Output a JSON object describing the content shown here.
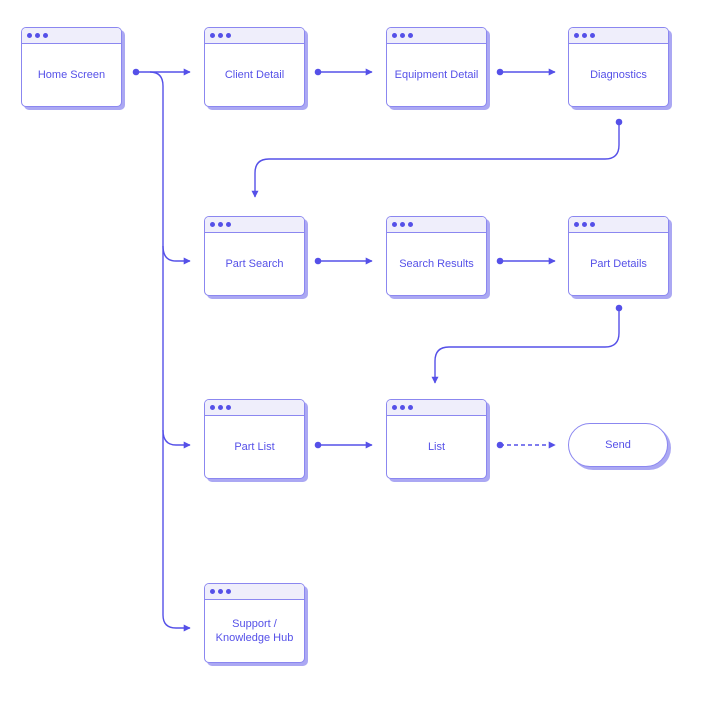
{
  "colors": {
    "accent": "#5550e8",
    "border": "#8b87f0",
    "header": "#efeefb",
    "shadow": "#aba8f3"
  },
  "nodes": {
    "home": {
      "label": "Home Screen",
      "type": "screen"
    },
    "client_detail": {
      "label": "Client Detail",
      "type": "screen"
    },
    "equipment_detail": {
      "label": "Equipment Detail",
      "type": "screen"
    },
    "diagnostics": {
      "label": "Diagnostics",
      "type": "screen"
    },
    "part_search": {
      "label": "Part Search",
      "type": "screen"
    },
    "search_results": {
      "label": "Search Results",
      "type": "screen"
    },
    "part_details": {
      "label": "Part Details",
      "type": "screen"
    },
    "part_list": {
      "label": "Part List",
      "type": "screen"
    },
    "list": {
      "label": "List",
      "type": "screen"
    },
    "send": {
      "label": "Send",
      "type": "action"
    },
    "support": {
      "label": "Support / Knowledge Hub",
      "type": "screen"
    }
  },
  "edges": [
    {
      "from": "home",
      "to": "client_detail",
      "style": "solid"
    },
    {
      "from": "client_detail",
      "to": "equipment_detail",
      "style": "solid"
    },
    {
      "from": "equipment_detail",
      "to": "diagnostics",
      "style": "solid"
    },
    {
      "from": "diagnostics",
      "to": "part_search",
      "style": "solid"
    },
    {
      "from": "home",
      "to": "part_search",
      "style": "solid"
    },
    {
      "from": "part_search",
      "to": "search_results",
      "style": "solid"
    },
    {
      "from": "search_results",
      "to": "part_details",
      "style": "solid"
    },
    {
      "from": "part_details",
      "to": "list",
      "style": "solid"
    },
    {
      "from": "home",
      "to": "part_list",
      "style": "solid"
    },
    {
      "from": "part_list",
      "to": "list",
      "style": "solid"
    },
    {
      "from": "list",
      "to": "send",
      "style": "dashed"
    },
    {
      "from": "home",
      "to": "support",
      "style": "solid"
    }
  ]
}
